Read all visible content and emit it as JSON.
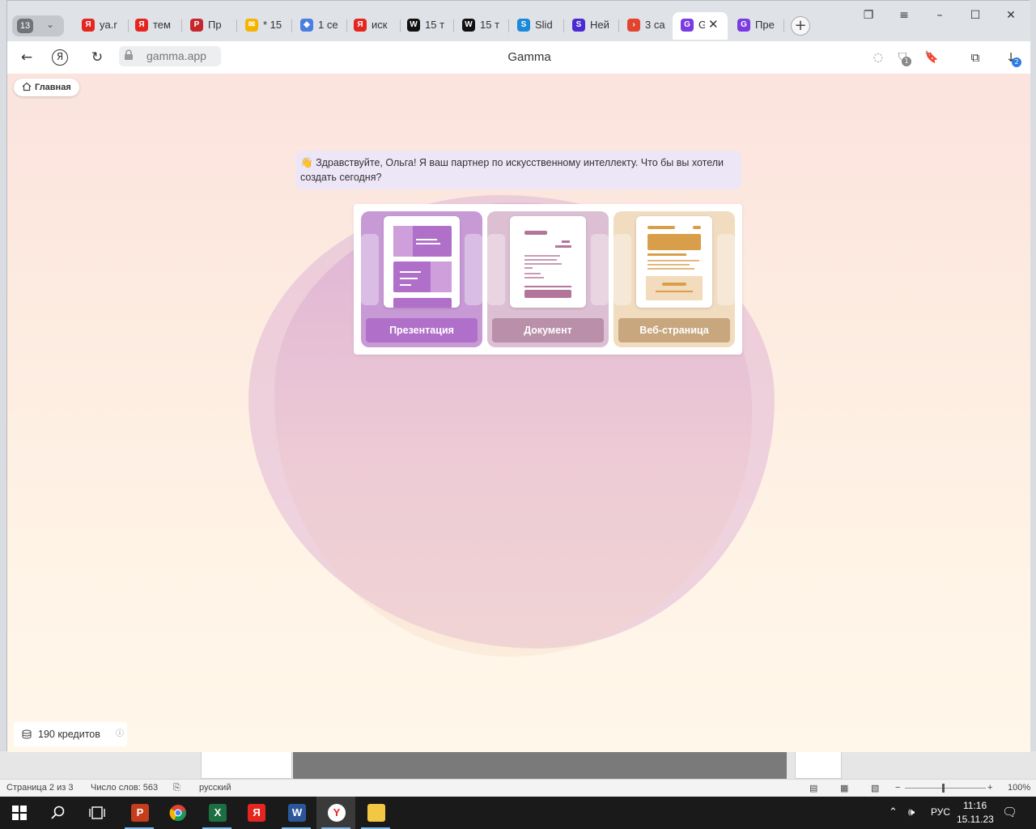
{
  "browser": {
    "tab_count": "13",
    "tabs": [
      {
        "label": "ya.r",
        "icon": "yandex-icon",
        "color": "#e52620",
        "glyph": "Я"
      },
      {
        "label": "тем",
        "icon": "yandex-icon",
        "color": "#e52620",
        "glyph": "Я"
      },
      {
        "label": "Пр",
        "icon": "p-icon",
        "color": "#c6272d",
        "glyph": "P"
      },
      {
        "label": "* 15",
        "icon": "mail-icon",
        "color": "#f5b400",
        "glyph": "✉"
      },
      {
        "label": "1 се",
        "icon": "cube-icon",
        "color": "#4a7fe0",
        "glyph": "◆"
      },
      {
        "label": "иск",
        "icon": "yandex-icon",
        "color": "#e52620",
        "glyph": "Я"
      },
      {
        "label": "15 т",
        "icon": "wf-icon",
        "color": "#111111",
        "glyph": "W"
      },
      {
        "label": "15 т",
        "icon": "wf-icon",
        "color": "#111111",
        "glyph": "W"
      },
      {
        "label": "Slid",
        "icon": "slides-icon",
        "color": "#1c8ad9",
        "glyph": "S"
      },
      {
        "label": "Ней",
        "icon": "s-icon",
        "color": "#4b2bd1",
        "glyph": "S"
      },
      {
        "label": "3 са",
        "icon": "arrow-icon",
        "color": "#e2452f",
        "glyph": "›"
      },
      {
        "label": "G",
        "icon": "gamma-icon",
        "color": "#7a3be0",
        "glyph": "G",
        "active": true
      },
      {
        "label": "Пре",
        "icon": "gamma-icon",
        "color": "#7a3be0",
        "glyph": "G"
      }
    ],
    "address": "gamma.app",
    "page_title": "Gamma",
    "badges": {
      "protect": "1",
      "downloads": "2"
    }
  },
  "page": {
    "home_label": "Главная",
    "greeting_emoji": "👋",
    "greeting": "Здравствуйте, Ольга! Я ваш партнер по искусственному интеллекту. Что бы вы хотели создать сегодня?",
    "cards": [
      {
        "label": "Презентация",
        "bg": "#c79ad6",
        "btn": "#b070c9",
        "accent": "#b070c9"
      },
      {
        "label": "Документ",
        "bg": "#dcbfd2",
        "btn": "#b98fa9",
        "accent": "#b3759a"
      },
      {
        "label": "Веб-страница",
        "bg": "#f1dcc0",
        "btn": "#c8a77f",
        "accent": "#d99e4a"
      }
    ],
    "credits": "190 кредитов"
  },
  "word_status": {
    "page": "Страница 2 из 3",
    "words": "Число слов: 563",
    "lang": "русский",
    "zoom": "100%"
  },
  "taskbar": {
    "lang": "РУС",
    "time": "11:16",
    "date": "15.11.23"
  }
}
